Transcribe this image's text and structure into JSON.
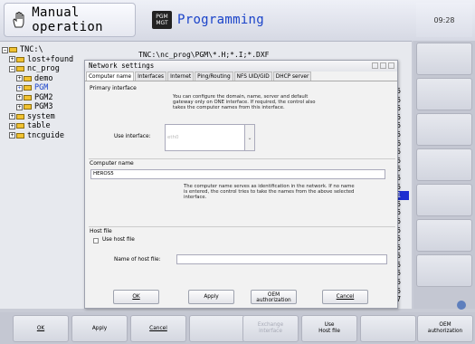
{
  "header": {
    "mode_manual": "Manual operation",
    "mode_programming": "Programming",
    "pgm_badge_top": "PGM",
    "pgm_badge_bottom": "MGT",
    "clock": "09:28"
  },
  "tree": {
    "items": [
      {
        "label": "TNC:\\",
        "indent": 0
      },
      {
        "label": "lost+found",
        "indent": 1
      },
      {
        "label": "nc_prog",
        "indent": 1
      },
      {
        "label": "demo",
        "indent": 2
      },
      {
        "label": "PGM",
        "indent": 2
      },
      {
        "label": "PGM2",
        "indent": 2
      },
      {
        "label": "PGM3",
        "indent": 2
      },
      {
        "label": "system",
        "indent": 1
      },
      {
        "label": "table",
        "indent": 1
      },
      {
        "label": "tncguide",
        "indent": 1
      }
    ],
    "path": "TNC:\\nc_prog\\PGM\\*.H;*.I;*.DXF"
  },
  "listing": {
    "numbers": [
      "55",
      "55",
      "55",
      "55",
      "55",
      "55",
      "46",
      "55",
      "55",
      "46",
      "55",
      "55",
      "31",
      "55",
      "55",
      "55",
      "55",
      "55",
      "55",
      "55",
      "55",
      "55",
      "55",
      "55",
      "57"
    ],
    "highlight_index": 12
  },
  "dialog": {
    "title": "Network settings",
    "tabs": [
      "Computer name",
      "Interfaces",
      "Internet",
      "Ping/Routing",
      "NFS UID/GID",
      "DHCP server"
    ],
    "primary": {
      "label": "Primary interface",
      "description": "You can configure the domain, name, server and default gateway only on ONE interface. If required, the control also takes the computer names from this interface.",
      "use_label": "Use interface:",
      "selected": "eth0"
    },
    "computer": {
      "label": "Computer name",
      "value": "HEROS5",
      "description": "The computer name serves as identification in the network. If no name is entered, the control tries to take the names from the above selected interface."
    },
    "host": {
      "label": "Host file",
      "checkbox_label": "Use host file",
      "name_label": "Name of host file:",
      "name_value": ""
    },
    "buttons": {
      "ok": "OK",
      "apply": "Apply",
      "oem_1": "OEM",
      "oem_2": "authorization",
      "cancel": "Cancel"
    }
  },
  "softkeys": {
    "ok": "OK",
    "apply": "Apply",
    "cancel": "Cancel",
    "exchange_1": "Exchange",
    "exchange_2": "interface",
    "use_1": "Use",
    "use_2": "Host file",
    "oem_1": "OEM",
    "oem_2": "authorization"
  }
}
